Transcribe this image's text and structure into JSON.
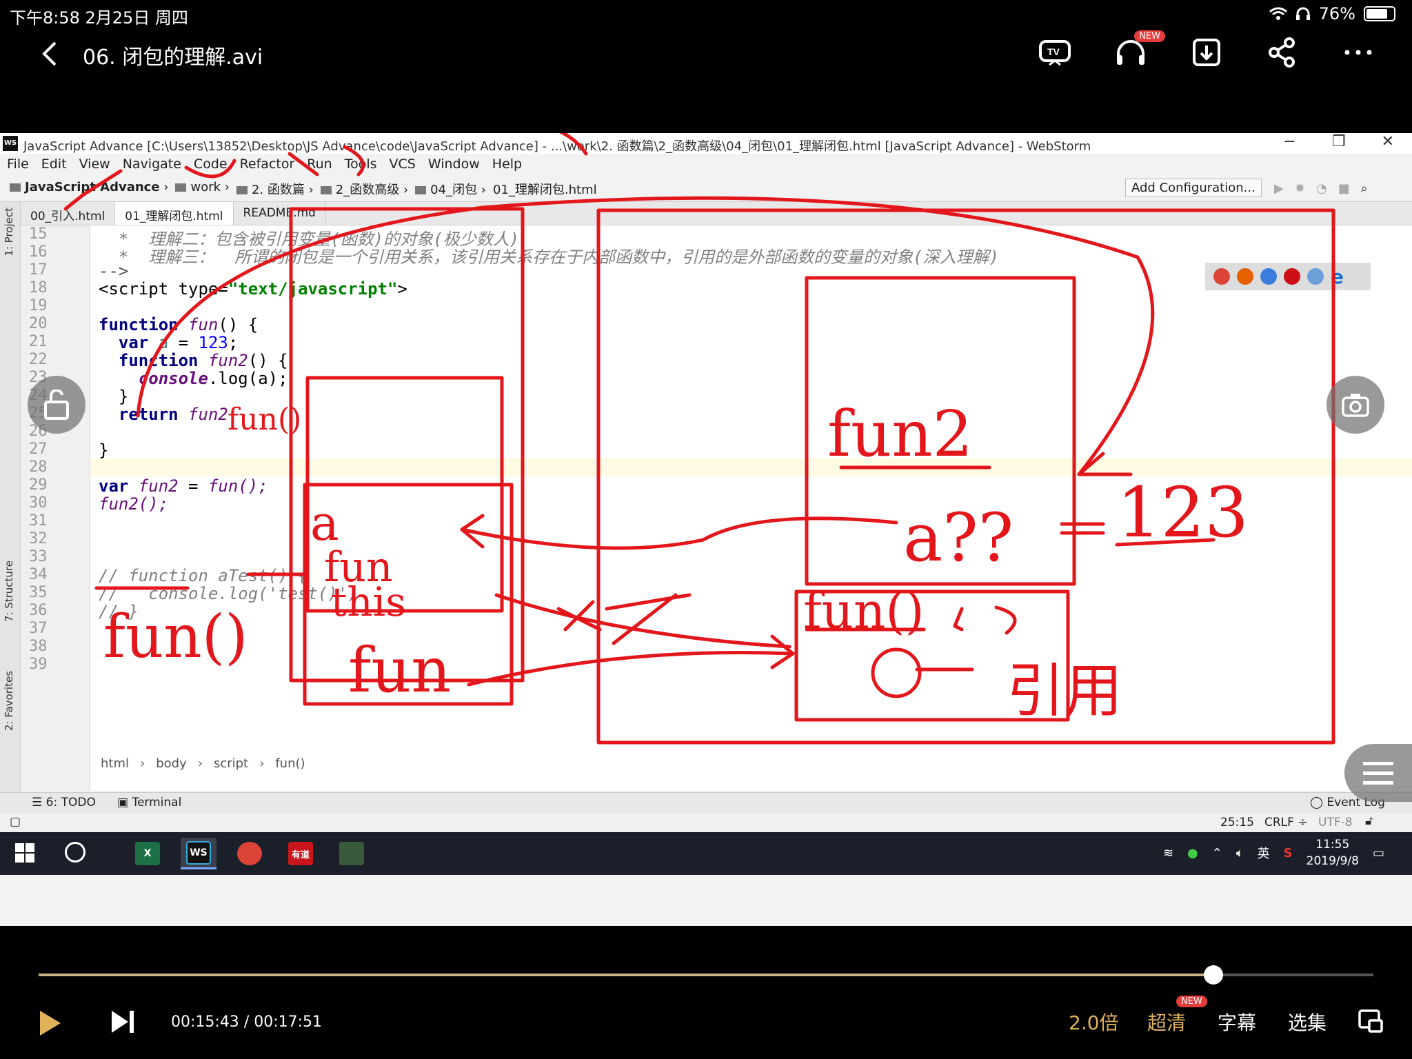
{
  "status_bar": {
    "time_date": "下午8:58   2月25日 周四",
    "battery": "76%"
  },
  "player": {
    "title": "06. 闭包的理解.avi",
    "new_badge": "NEW",
    "current_time": "00:15:43",
    "total_time": "00:17:51",
    "progress": 0.88,
    "speed": "2.0倍",
    "quality": "超清",
    "subtitle": "字幕",
    "episodes": "选集"
  },
  "ide": {
    "window_title": "JavaScript Advance [C:\\Users\\13852\\Desktop\\JS Advance\\code\\JavaScript Advance] - ...\\work\\2. 函数篇\\2_函数高级\\04_闭包\\01_理解闭包.html [JavaScript Advance] - WebStorm",
    "logo": "WS",
    "menu": [
      "File",
      "Edit",
      "View",
      "Navigate",
      "Code",
      "Refactor",
      "Run",
      "Tools",
      "VCS",
      "Window",
      "Help"
    ],
    "breadcrumbs": [
      "JavaScript Advance",
      "work",
      "2. 函数篇",
      "2_函数高级",
      "04_闭包",
      "01_理解闭包.html"
    ],
    "add_configuration": "Add Configuration...",
    "tabs": [
      "00_引入.html",
      "01_理解闭包.html",
      "README.md"
    ],
    "side_labels": {
      "project": "1: Project",
      "structure": "7: Structure",
      "favorites": "2: Favorites"
    },
    "line_numbers": [
      "15",
      "16",
      "17",
      "18",
      "19",
      "20",
      "21",
      "22",
      "23",
      "24",
      "25",
      "26",
      "27",
      "28",
      "29",
      "30",
      "31",
      "32",
      "33",
      "34",
      "35",
      "36",
      "37",
      "38",
      "39"
    ],
    "code": {
      "l15": "  *  理解二：包含被引用变量(函数)的对象(极少数人)",
      "l16": "  *  理解三：  所谓的闭包是一个引用关系，该引用关系存在于内部函数中，引用的是外部函数的变量的对象(深入理解)",
      "l17": "-->",
      "l18_open": "<script type=",
      "l18_str": "\"text/javascript\"",
      "l18_close": ">",
      "l20_kw": "function",
      "l20_fn": " fun",
      "l20_rest": "() {",
      "l21_kw": "  var",
      "l21_var": " a",
      "l21_eq": " = ",
      "l21_num": "123",
      "l21_end": ";",
      "l22_kw": "  function",
      "l22_fn": " fun2",
      "l22_rest": "() {",
      "l23_a": "    console",
      "l23_b": ".log(a);",
      "l24": "  }",
      "l25_kw": "  return",
      "l25_fn": " fun2",
      "l27": "}",
      "l29_kw": "var",
      "l29_fn": " fun2",
      "l29_eq": " = ",
      "l29_call": "fun();",
      "l30": "fun2();",
      "l34": "// function aTest() {",
      "l35": "//   console.log('test()')",
      "l36": "// }"
    },
    "editor_breadcrumb": [
      "html",
      "body",
      "script",
      "fun()"
    ],
    "bottom_tools": {
      "todo": "6: TODO",
      "terminal": "Terminal",
      "event_log": "Event Log"
    },
    "status": {
      "position": "25:15",
      "line_sep": "CRLF ÷",
      "encoding": "UTF-8"
    },
    "ime": "英"
  },
  "taskbar": {
    "apps": [
      "X",
      "WS",
      "",
      "有道",
      ""
    ],
    "ime": "英",
    "time": "11:55",
    "date": "2019/9/8"
  },
  "annotations": {
    "ink_color": "#e3161b",
    "handwritten": [
      "fun2",
      "a??",
      "123",
      "a",
      "fun",
      "this",
      "fun",
      "fun()",
      "fun()",
      "fun()",
      "o",
      "引用",
      "x x"
    ]
  }
}
